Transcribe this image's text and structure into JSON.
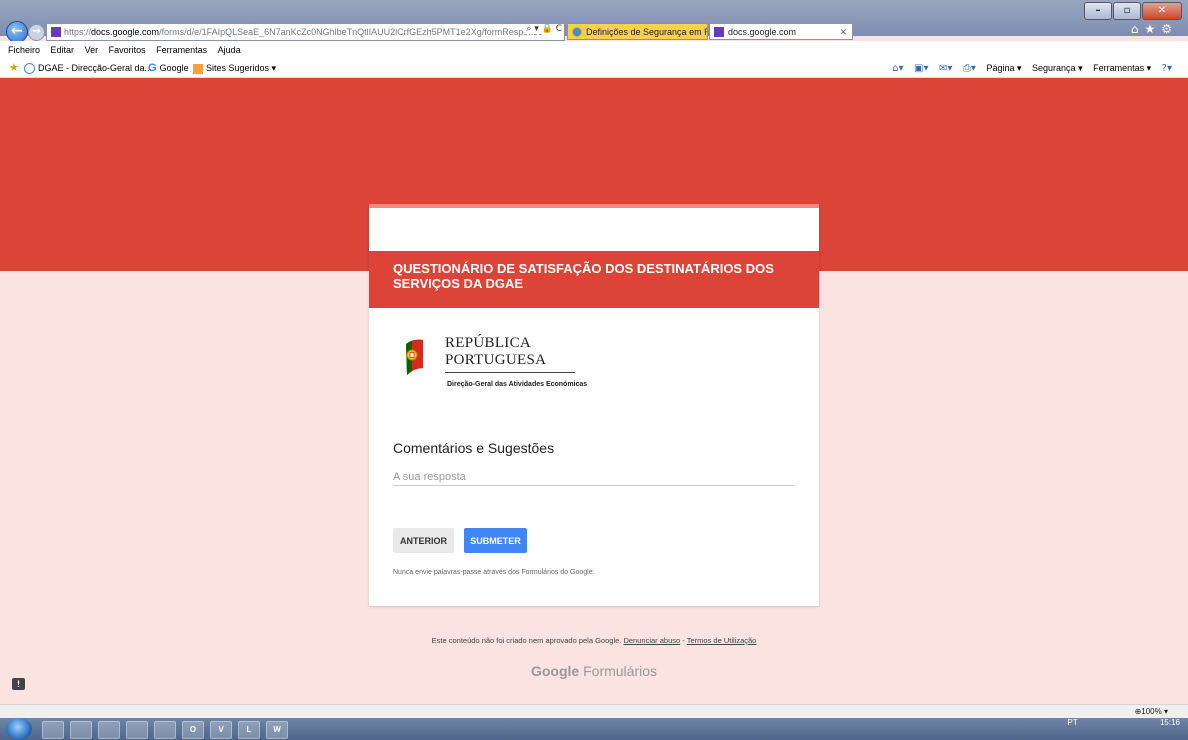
{
  "browser": {
    "url_prefix": "https://",
    "url_host": "docs.google.com",
    "url_path": "/forms/d/e/1FAIpQLSeaE_6N7anKcZc0NGhlbeTnQtlIAUU2lCrfGEzh5PMT1e2Xg/formResponse",
    "address_tools": "⌕ ▾ 🔒 C",
    "tabs": [
      {
        "label": "Definições de Segurança em Ri..."
      },
      {
        "label": "docs.google.com"
      }
    ],
    "menu": [
      "Ficheiro",
      "Editar",
      "Ver",
      "Favoritos",
      "Ferramentas",
      "Ajuda"
    ],
    "favorites": [
      "DGAE - Direcção-Geral da...",
      "Google",
      "Sites Sugeridos ▾"
    ],
    "command_bar": [
      "Página ▾",
      "Segurança ▾",
      "Ferramentas ▾"
    ],
    "zoom": "100%"
  },
  "form": {
    "title": "QUESTIONÁRIO DE SATISFAÇÃO DOS DESTINATÁRIOS DOS SERVIÇOS DA DGAE",
    "logo": {
      "line1": "REPÚBLICA",
      "line2": "PORTUGUESA",
      "agency": "Direção-Geral das Atividades Económicas"
    },
    "question": "Comentários e Sugestões",
    "answer_placeholder": "A sua resposta",
    "prev_label": "ANTERIOR",
    "submit_label": "SUBMETER",
    "password_note": "Nunca envie palavras-passe através dos Formulários do Google."
  },
  "footer": {
    "disclaimer": "Este conteúdo não foi criado nem aprovado pela Google.",
    "report_link": "Denunciar abuso",
    "separator": "-",
    "terms_link": "Termos de Utilização",
    "brand_google": "Google",
    "brand_forms": "Formulários"
  },
  "taskbar": {
    "buttons": [
      "",
      "",
      "",
      "",
      "",
      "O",
      "V",
      "L",
      "W"
    ],
    "lang": "PT",
    "clock": "15:16"
  },
  "colors": {
    "header_red": "#db4437",
    "background_pink": "#fae3e1",
    "submit_blue": "#4285f4"
  }
}
